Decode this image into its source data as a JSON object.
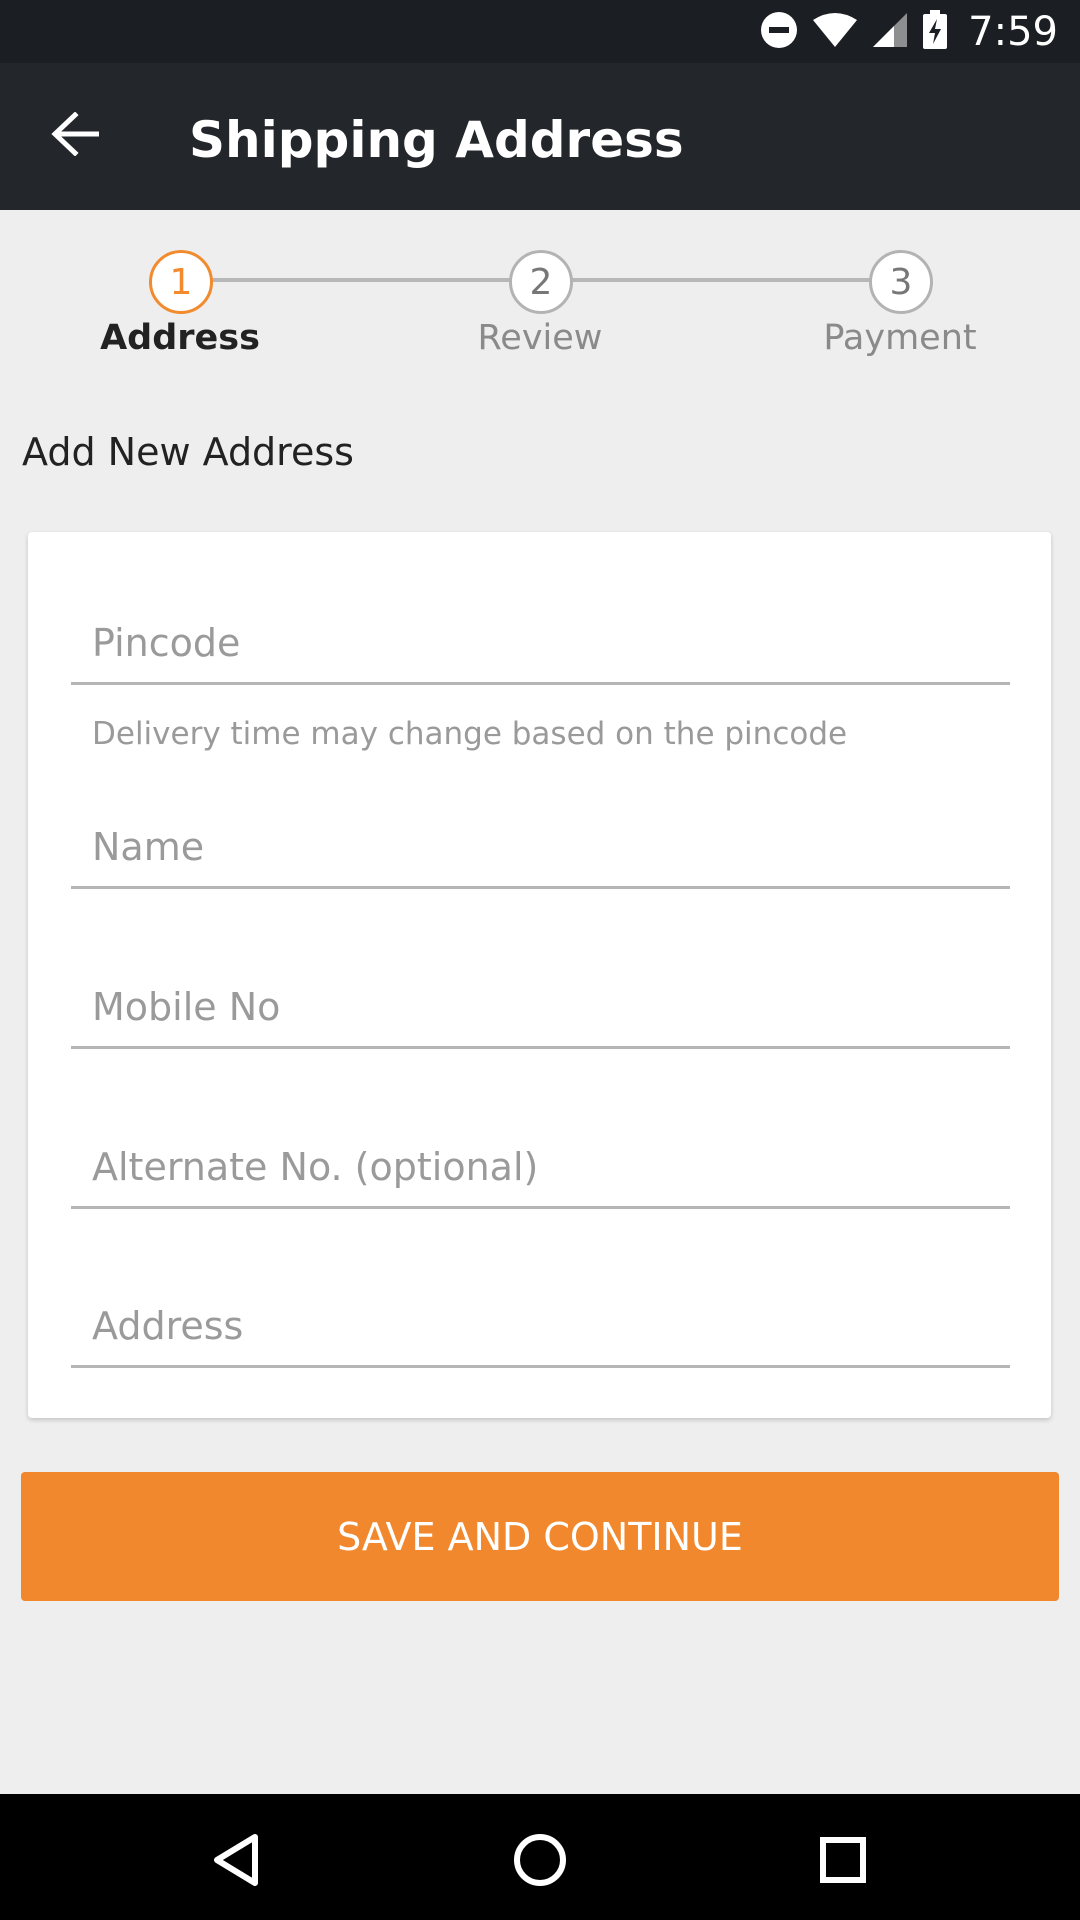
{
  "status_bar": {
    "time": "7:59"
  },
  "app_bar": {
    "title": "Shipping Address"
  },
  "stepper": {
    "steps": [
      {
        "number": "1",
        "label": "Address"
      },
      {
        "number": "2",
        "label": "Review"
      },
      {
        "number": "3",
        "label": "Payment"
      }
    ],
    "active_step": 1
  },
  "form": {
    "section_title": "Add New Address",
    "pincode": {
      "placeholder": "Pincode",
      "value": ""
    },
    "pincode_helper": "Delivery time may change based on the pincode",
    "name": {
      "placeholder": "Name",
      "value": ""
    },
    "mobile": {
      "placeholder": "Mobile No",
      "value": ""
    },
    "alternate": {
      "placeholder": "Alternate No. (optional)",
      "value": ""
    },
    "address": {
      "placeholder": "Address",
      "value": ""
    }
  },
  "actions": {
    "save_label": "SAVE AND CONTINUE"
  },
  "colors": {
    "accent": "#f28a2e",
    "app_bar": "#23272b",
    "status_bar": "#1b1e22"
  },
  "icons": [
    "dnd-icon",
    "wifi-icon",
    "signal-icon",
    "battery-charging-icon",
    "back-arrow-icon",
    "nav-back-icon",
    "nav-home-icon",
    "nav-recents-icon"
  ]
}
